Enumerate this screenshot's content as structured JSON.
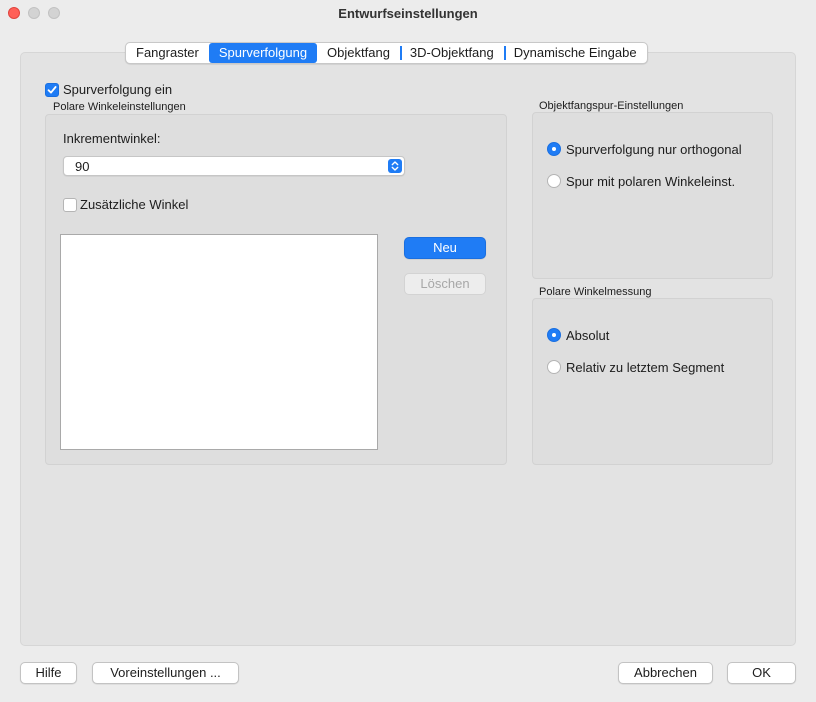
{
  "window": {
    "title": "Entwurfseinstellungen"
  },
  "tabs": [
    {
      "label": "Fangraster",
      "active": false
    },
    {
      "label": "Spurverfolgung",
      "active": true
    },
    {
      "label": "Objektfang",
      "active": false
    },
    {
      "label": "3D-Objektfang",
      "active": false
    },
    {
      "label": "Dynamische Eingabe",
      "active": false
    }
  ],
  "tracking": {
    "enable_label": "Spurverfolgung ein",
    "enable_checked": true
  },
  "polar": {
    "group_label": "Polare Winkeleinstellungen",
    "increment_label": "Inkrementwinkel:",
    "increment_value": "90",
    "additional_label": "Zusätzliche Winkel",
    "additional_checked": false,
    "new_button": "Neu",
    "delete_button": "Löschen"
  },
  "osnap_tracking": {
    "group_label": "Objektfangspur-Einstellungen",
    "options": [
      {
        "label": "Spurverfolgung nur orthogonal",
        "selected": true
      },
      {
        "label": "Spur mit polaren Winkeleinst.",
        "selected": false
      }
    ]
  },
  "polar_measure": {
    "group_label": "Polare Winkelmessung",
    "options": [
      {
        "label": "Absolut",
        "selected": true
      },
      {
        "label": "Relativ zu letztem Segment",
        "selected": false
      }
    ]
  },
  "footer": {
    "help": "Hilfe",
    "defaults": "Voreinstellungen ...",
    "cancel": "Abbrechen",
    "ok": "OK"
  },
  "colors": {
    "accent": "#1f7cf5",
    "close": "#ff5f57"
  }
}
